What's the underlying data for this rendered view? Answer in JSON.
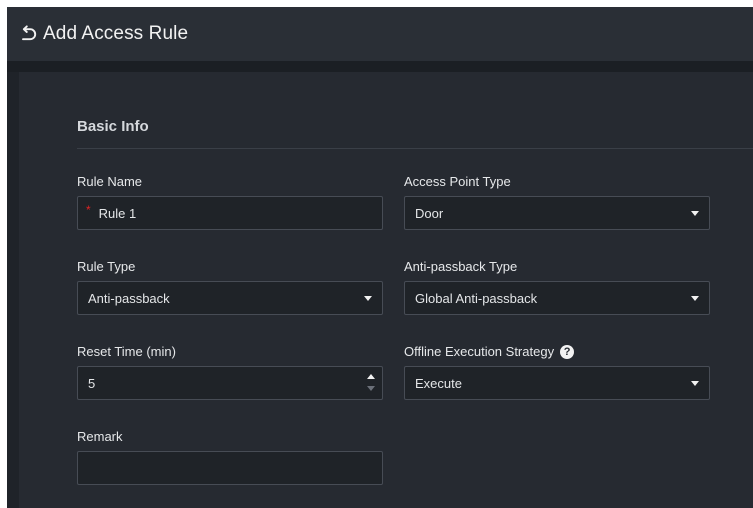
{
  "header": {
    "title": "Add Access Rule",
    "back_icon": "back-arrow-icon"
  },
  "section": {
    "title": "Basic Info"
  },
  "fields": {
    "rule_name": {
      "label": "Rule Name",
      "value": "Rule 1",
      "required_mark": "*"
    },
    "access_point_type": {
      "label": "Access Point Type",
      "value": "Door"
    },
    "rule_type": {
      "label": "Rule Type",
      "value": "Anti-passback"
    },
    "anti_passback_type": {
      "label": "Anti-passback Type",
      "value": "Global Anti-passback"
    },
    "reset_time": {
      "label": "Reset Time (min)",
      "value": "5"
    },
    "offline_strategy": {
      "label": "Offline Execution Strategy",
      "value": "Execute",
      "help_icon": "question-mark",
      "help_glyph": "?"
    },
    "remark": {
      "label": "Remark",
      "value": ""
    }
  },
  "colors": {
    "header_bg": "#2a2f36",
    "panel_bg": "#262a31",
    "field_bg": "#1f2328",
    "required": "#e02424"
  }
}
